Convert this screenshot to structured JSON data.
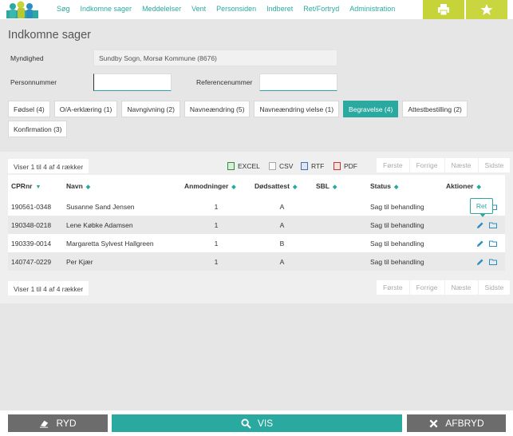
{
  "nav": {
    "links": [
      "Søg",
      "Indkomne sager",
      "Meddelelser",
      "Vent",
      "Personsiden",
      "Indberet",
      "Ret/Fortryd",
      "Administration"
    ]
  },
  "page": {
    "title": "Indkomne sager"
  },
  "form": {
    "myndighed_label": "Myndighed",
    "myndighed_value": "Sundby Sogn, Morsø Kommune (8676)",
    "personnummer_label": "Personnummer",
    "personnummer_value": "",
    "referencenummer_label": "Referencenummer",
    "referencenummer_value": ""
  },
  "tabs": [
    {
      "label": "Fødsel (4)",
      "active": false
    },
    {
      "label": "O/A-erklæring (1)",
      "active": false
    },
    {
      "label": "Navngivning (2)",
      "active": false
    },
    {
      "label": "Navneændring (5)",
      "active": false
    },
    {
      "label": "Navneændring vielse (1)",
      "active": false
    },
    {
      "label": "Begravelse (4)",
      "active": true
    },
    {
      "label": "Attestbestilling (2)",
      "active": false
    },
    {
      "label": "Konfirmation (3)",
      "active": false
    }
  ],
  "table": {
    "info_top": "Viser 1 til 4 af 4 rækker",
    "info_bottom": "Viser 1 til 4 af 4 rækker",
    "exports": [
      "EXCEL",
      "CSV",
      "RTF",
      "PDF"
    ],
    "pager": [
      "Første",
      "Forrige",
      "Næste",
      "Sidste"
    ],
    "columns": [
      "CPRnr",
      "Navn",
      "Anmodninger",
      "Dødsattest",
      "SBL",
      "Status",
      "Aktioner"
    ],
    "rows": [
      {
        "cpr": "190561-0348",
        "navn": "Susanne Sand Jensen",
        "anmodninger": "1",
        "dodsattest": "A",
        "sbl": "",
        "status": "Sag til behandling"
      },
      {
        "cpr": "190348-0218",
        "navn": "Lene Købke Adamsen",
        "anmodninger": "1",
        "dodsattest": "A",
        "sbl": "",
        "status": "Sag til behandling"
      },
      {
        "cpr": "190339-0014",
        "navn": "Margaretta Sylvest Hallgreen",
        "anmodninger": "1",
        "dodsattest": "B",
        "sbl": "",
        "status": "Sag til behandling"
      },
      {
        "cpr": "140747-0229",
        "navn": "Per Kjær",
        "anmodninger": "1",
        "dodsattest": "A",
        "sbl": "",
        "status": "Sag til behandling"
      }
    ],
    "tooltip": "Ret"
  },
  "buttons": {
    "ryd": "RYD",
    "vis": "VIS",
    "afbryd": "AFBRYD"
  },
  "colors": {
    "accent": "#2aa9a0",
    "nav_button": "#c6d43a",
    "dark_button": "#6c6c6c"
  },
  "icons": {
    "print": "printer-icon",
    "star": "star-icon",
    "edit": "pencil-icon",
    "folder": "folder-icon",
    "eraser": "eraser-icon",
    "search": "search-icon",
    "close": "close-icon"
  }
}
